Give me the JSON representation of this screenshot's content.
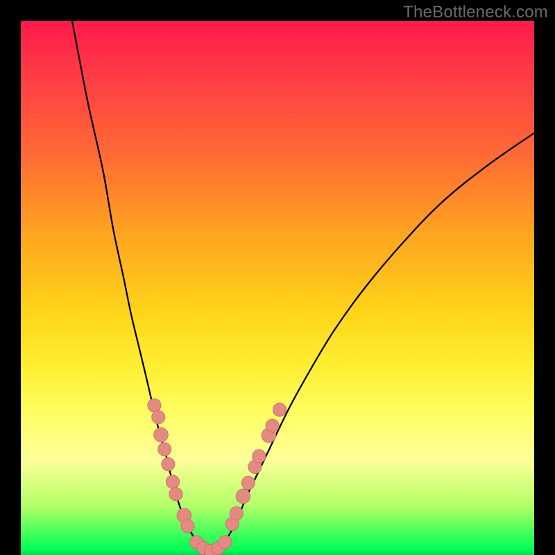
{
  "watermark": {
    "text": "TheBottleneck.com"
  },
  "colors": {
    "curve_stroke": "#000000",
    "dot_fill": "#e58a82",
    "dot_stroke": "#c46a64",
    "frame": "#000000"
  },
  "chart_data": {
    "type": "line",
    "title": "",
    "xlabel": "",
    "ylabel": "",
    "xlim": [
      0,
      100
    ],
    "ylim": [
      0,
      100
    ],
    "note": "Values are positions in percent of the plot area (x left→right, y top→bottom). The curve is a V-shaped bottleneck curve with left and right arms; dots mark cluster points near the valley.",
    "series": [
      {
        "name": "left-arm",
        "x": [
          10,
          13,
          16,
          18,
          20,
          21.5,
          23,
          24.5,
          25.7,
          27,
          28.2,
          29.2,
          30.2,
          31,
          32,
          33,
          34.2
        ],
        "y": [
          0,
          15,
          28,
          39,
          48,
          55,
          61,
          67,
          72,
          77,
          81,
          85,
          88.5,
          91,
          93.5,
          95.5,
          97.5
        ]
      },
      {
        "name": "valley",
        "x": [
          34.2,
          35.5,
          37,
          38.5,
          39.8
        ],
        "y": [
          97.5,
          98.8,
          99.3,
          98.8,
          97.5
        ]
      },
      {
        "name": "right-arm",
        "x": [
          39.8,
          41,
          42.5,
          44,
          46,
          48.5,
          52,
          56,
          61,
          67,
          74,
          82,
          91,
          100
        ],
        "y": [
          97.5,
          95.5,
          92.5,
          89,
          85,
          80,
          73,
          66,
          58,
          50,
          42,
          34,
          27,
          21
        ]
      }
    ],
    "dots_left": [
      {
        "x": 26.0,
        "y": 72.0,
        "r": 1.3
      },
      {
        "x": 26.8,
        "y": 74.2,
        "r": 1.3
      },
      {
        "x": 27.3,
        "y": 77.5,
        "r": 1.4
      },
      {
        "x": 28.0,
        "y": 80.2,
        "r": 1.3
      },
      {
        "x": 28.7,
        "y": 83.0,
        "r": 1.3
      },
      {
        "x": 29.6,
        "y": 86.3,
        "r": 1.3
      },
      {
        "x": 30.2,
        "y": 88.6,
        "r": 1.3
      },
      {
        "x": 31.8,
        "y": 92.6,
        "r": 1.4
      },
      {
        "x": 32.5,
        "y": 94.6,
        "r": 1.3
      }
    ],
    "dots_right": [
      {
        "x": 41.2,
        "y": 94.2,
        "r": 1.3
      },
      {
        "x": 42.0,
        "y": 92.2,
        "r": 1.3
      },
      {
        "x": 43.3,
        "y": 89.0,
        "r": 1.4
      },
      {
        "x": 44.3,
        "y": 86.5,
        "r": 1.3
      },
      {
        "x": 45.6,
        "y": 83.5,
        "r": 1.3
      },
      {
        "x": 46.4,
        "y": 81.5,
        "r": 1.3
      },
      {
        "x": 48.3,
        "y": 77.6,
        "r": 1.4
      },
      {
        "x": 49.0,
        "y": 75.8,
        "r": 1.3
      },
      {
        "x": 50.4,
        "y": 72.8,
        "r": 1.3
      }
    ],
    "dots_valley": [
      {
        "x": 34.2,
        "y": 97.6,
        "r": 1.3
      },
      {
        "x": 35.6,
        "y": 98.7,
        "r": 1.3
      },
      {
        "x": 37.0,
        "y": 99.2,
        "r": 1.3
      },
      {
        "x": 38.4,
        "y": 98.7,
        "r": 1.3
      },
      {
        "x": 39.8,
        "y": 97.6,
        "r": 1.3
      }
    ]
  }
}
